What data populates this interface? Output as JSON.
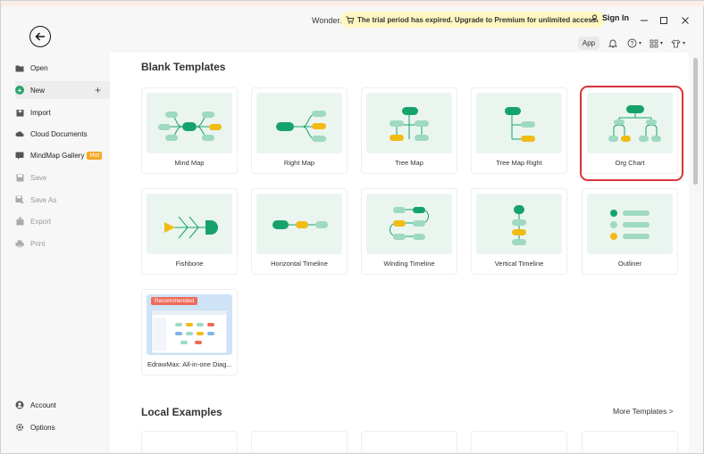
{
  "titlebar": {
    "app_name": "Wonders",
    "trial_message": "The trial period has expired. Upgrade to Premium for unlimited access.",
    "sign_in": "Sign In",
    "app_label": "App"
  },
  "sidebar": {
    "items": [
      {
        "label": "Open",
        "icon": "folder-icon"
      },
      {
        "label": "New",
        "icon": "plus-circle-icon"
      },
      {
        "label": "Import",
        "icon": "import-icon"
      },
      {
        "label": "Cloud Documents",
        "icon": "cloud-icon"
      },
      {
        "label": "MindMap Gallery",
        "icon": "gallery-icon",
        "badge": "Hot"
      },
      {
        "label": "Save",
        "icon": "save-icon"
      },
      {
        "label": "Save As",
        "icon": "save-as-icon"
      },
      {
        "label": "Export",
        "icon": "export-icon"
      },
      {
        "label": "Print",
        "icon": "print-icon"
      },
      {
        "label": "Account",
        "icon": "account-icon"
      },
      {
        "label": "Options",
        "icon": "gear-icon"
      }
    ]
  },
  "main": {
    "blank_templates_title": "Blank Templates",
    "templates": [
      {
        "label": "Mind Map"
      },
      {
        "label": "Right Map"
      },
      {
        "label": "Tree Map"
      },
      {
        "label": "Tree Map Right"
      },
      {
        "label": "Org Chart"
      },
      {
        "label": "Fishbone"
      },
      {
        "label": "Horizontal Timeline"
      },
      {
        "label": "Winding Timeline"
      },
      {
        "label": "Vertical Timeline"
      },
      {
        "label": "Outliner"
      }
    ],
    "recommended": {
      "badge": "Recommended",
      "label": "EdrawMax: All-in-one Diag..."
    },
    "local_examples_title": "Local Examples",
    "more_templates": "More Templates >"
  },
  "colors": {
    "accent_green": "#2ea36b",
    "node_teal": "#16a36b",
    "node_light": "#9fd9c1",
    "node_yellow": "#f2bb13",
    "selected_outline": "#d9343a",
    "trial_bg": "#fff7c2"
  }
}
